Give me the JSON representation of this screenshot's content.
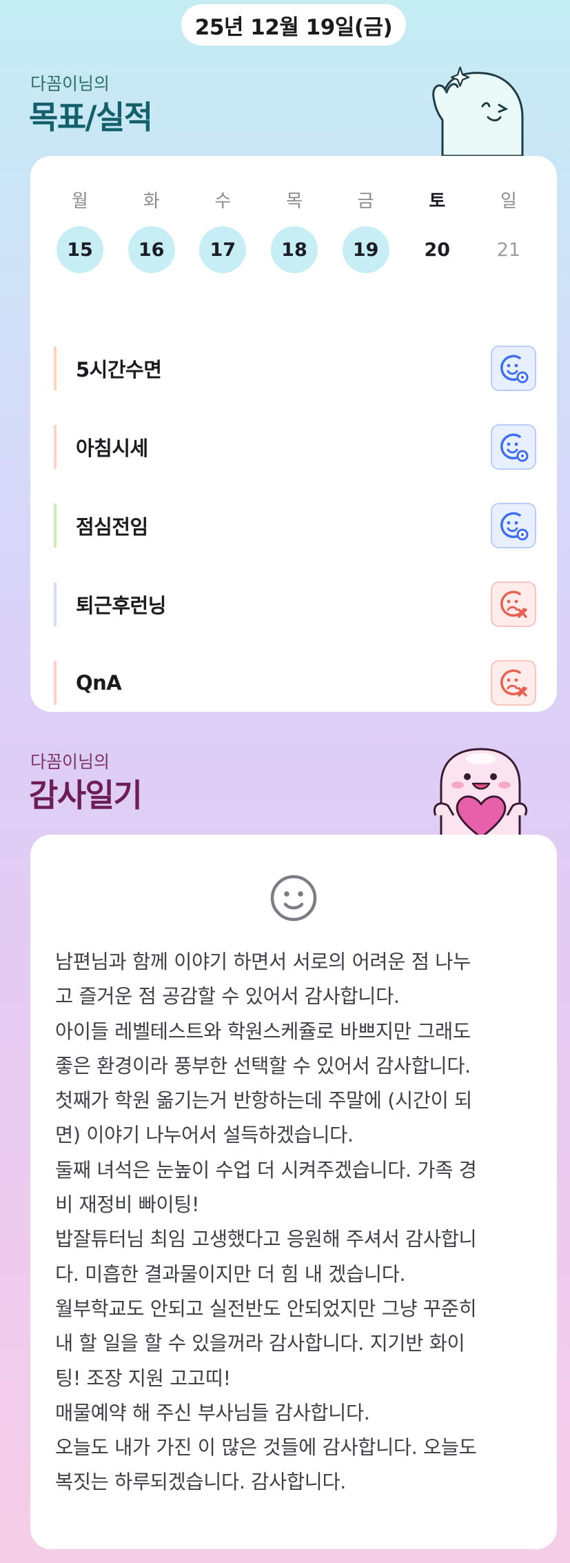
{
  "header": {
    "date": "25년 12월 19일(금)"
  },
  "goals_section": {
    "subtitle": "다꼼이님의",
    "title": "목표/실적"
  },
  "week": [
    {
      "day": "월",
      "date": "15",
      "state": "done"
    },
    {
      "day": "화",
      "date": "16",
      "state": "done"
    },
    {
      "day": "수",
      "date": "17",
      "state": "done"
    },
    {
      "day": "목",
      "date": "18",
      "state": "done"
    },
    {
      "day": "금",
      "date": "19",
      "state": "done"
    },
    {
      "day": "토",
      "date": "20",
      "state": "today"
    },
    {
      "day": "일",
      "date": "21",
      "state": "future"
    }
  ],
  "goals": [
    {
      "label": "5시간수면",
      "status": "success",
      "bar_color": "#ffd6b8"
    },
    {
      "label": "아침시세",
      "status": "success",
      "bar_color": "#ffd1cc"
    },
    {
      "label": "점심전임",
      "status": "success",
      "bar_color": "#cdebb6"
    },
    {
      "label": "퇴근후런닝",
      "status": "fail",
      "bar_color": "#d8dcf8"
    },
    {
      "label": "QnA",
      "status": "fail",
      "bar_color": "#ffcfc8"
    }
  ],
  "status_icons": {
    "success": "smile-check-icon",
    "fail": "frown-x-icon"
  },
  "colors": {
    "success": "#3d6ef0",
    "fail": "#e8604f",
    "accent_day": "#c7eef4"
  },
  "diary_section": {
    "subtitle": "다꼼이님의",
    "title": "감사일기"
  },
  "diary": {
    "icon": "smile-icon",
    "lines": [
      "남편님과 함께 이야기 하면서 서로의 어려운 점 나누",
      "고 즐거운 점 공감할 수 있어서 감사합니다.",
      "아이들 레벨테스트와 학원스케쥴로 바쁘지만 그래도",
      "좋은 환경이라 풍부한 선택할 수 있어서 감사합니다.",
      "첫째가 학원 옮기는거 반항하는데 주말에 (시간이 되",
      "면) 이야기 나누어서 설득하겠습니다.",
      "둘째 녀석은 눈높이 수업 더 시켜주겠습니다. 가족 경",
      "비 재정비 빠이팅!",
      "밥잘튜터님 최임 고생했다고 응원해 주셔서 감사합니",
      "다. 미흡한 결과물이지만 더 힘 내 겠습니다.",
      "월부학교도 안되고 실전반도 안되었지만 그냥 꾸준히",
      "내 할 일을 할 수 있을꺼라 감사합니다. 지기반 화이",
      "팅! 조장 지원 고고띠!",
      "매물예약 해 주신 부사님들 감사합니다.",
      "오늘도 내가 가진 이 많은 것들에 감사합니다. 오늘도",
      "복짓는 하루되겠습니다. 감사합니다."
    ]
  }
}
